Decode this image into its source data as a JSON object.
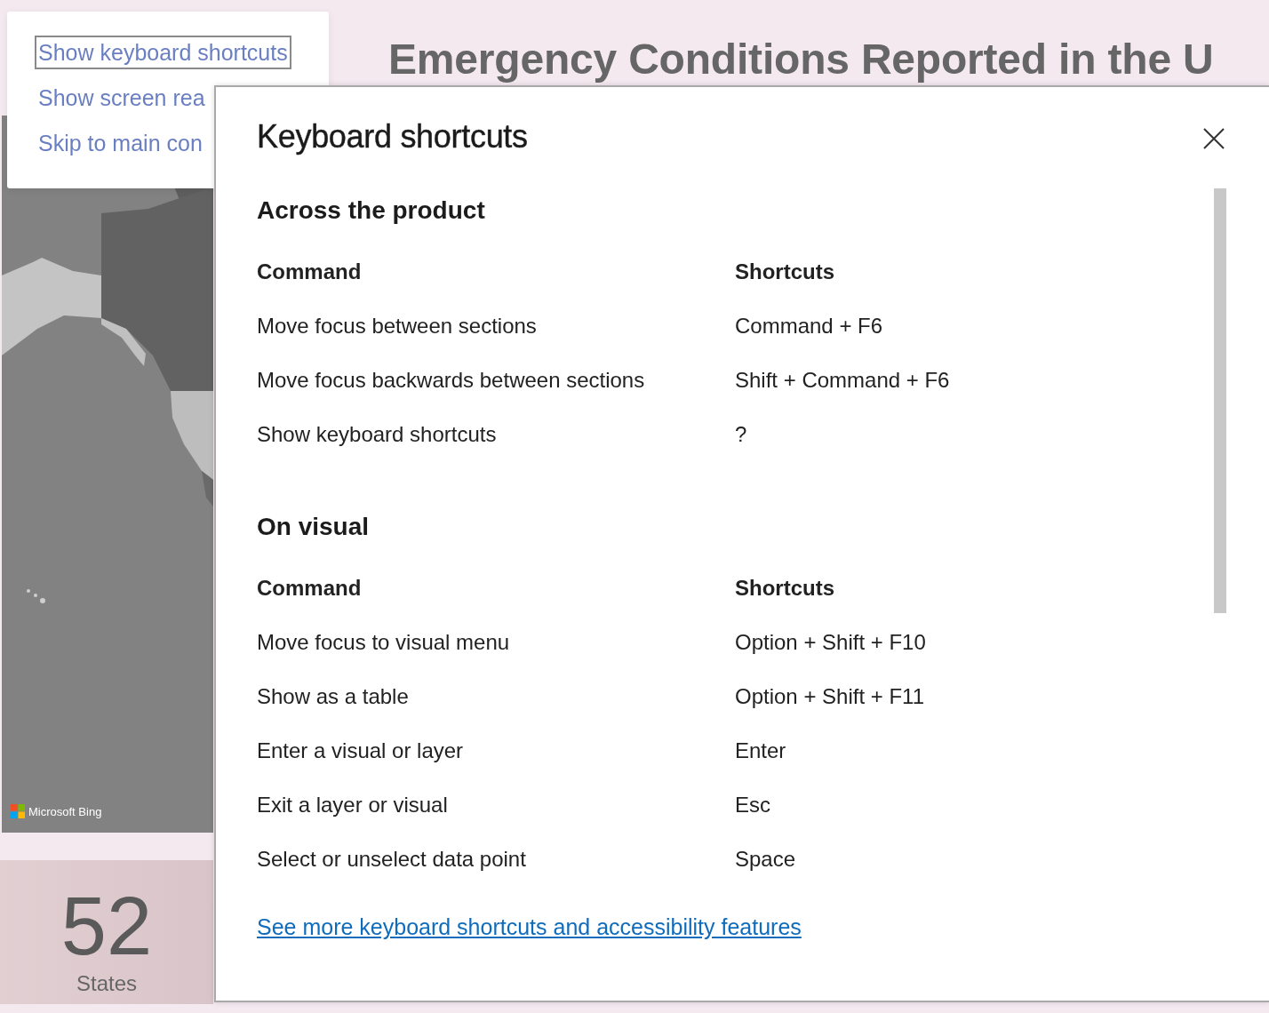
{
  "skip_links": [
    {
      "label": "Show keyboard shortcuts",
      "focused": true
    },
    {
      "label": "Show screen rea",
      "focused": false
    },
    {
      "label": "Skip to main con",
      "focused": false
    }
  ],
  "report": {
    "title": "Emergency Conditions Reported in the U",
    "map": {
      "kind": "picture",
      "attribution": "Microsoft Bing"
    },
    "card": {
      "value": "52",
      "label": "States"
    }
  },
  "dialog": {
    "title": "Keyboard shortcuts",
    "sections": [
      {
        "heading": "Across the product",
        "columns": [
          "Command",
          "Shortcuts"
        ],
        "rows": [
          {
            "command": "Move focus between sections",
            "shortcut": "Command + F6"
          },
          {
            "command": "Move focus backwards between sections",
            "shortcut": "Shift + Command + F6"
          },
          {
            "command": "Show keyboard shortcuts",
            "shortcut": "?"
          }
        ]
      },
      {
        "heading": "On visual",
        "columns": [
          "Command",
          "Shortcuts"
        ],
        "rows": [
          {
            "command": "Move focus to visual menu",
            "shortcut": "Option + Shift + F10"
          },
          {
            "command": "Show as a table",
            "shortcut": "Option + Shift + F11"
          },
          {
            "command": "Enter a visual or layer",
            "shortcut": "Enter"
          },
          {
            "command": "Exit a layer or visual",
            "shortcut": "Esc"
          },
          {
            "command": "Select or unselect data point",
            "shortcut": "Space"
          }
        ]
      }
    ],
    "link": "See more keyboard shortcuts and accessibility features"
  }
}
